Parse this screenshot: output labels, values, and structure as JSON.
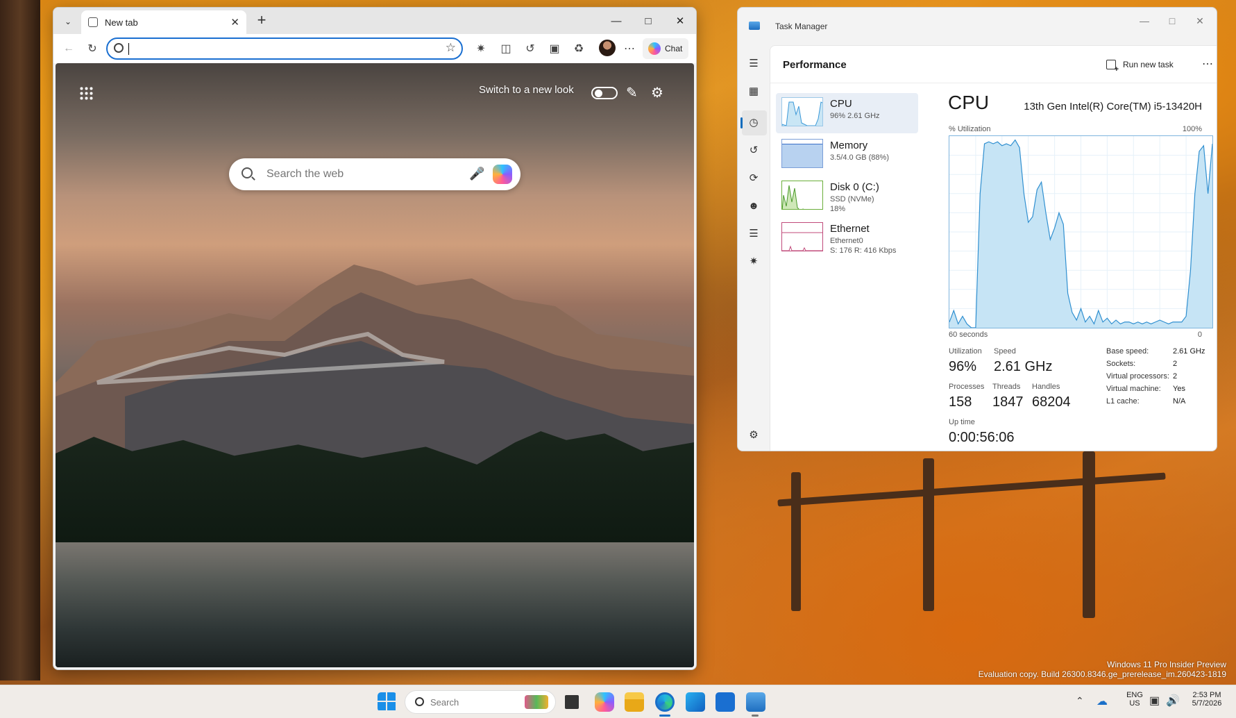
{
  "desktop": {
    "watermark_line1": "Windows 11 Pro Insider Preview",
    "watermark_line2": "Evaluation copy. Build 26300.8346.ge_prerelease_im.260423-1819"
  },
  "browser": {
    "tab_title": "New tab",
    "address_value": "",
    "chat_label": "Chat",
    "newtab": {
      "switch_label": "Switch to a new look",
      "search_placeholder": "Search the web"
    }
  },
  "task_manager": {
    "window_title": "Task Manager",
    "page_title": "Performance",
    "run_new_task": "Run new task",
    "resources": [
      {
        "name": "CPU",
        "sub1": "96%  2.61 GHz",
        "sub2": ""
      },
      {
        "name": "Memory",
        "sub1": "3.5/4.0 GB (88%)",
        "sub2": ""
      },
      {
        "name": "Disk 0 (C:)",
        "sub1": "SSD (NVMe)",
        "sub2": "18%"
      },
      {
        "name": "Ethernet",
        "sub1": "Ethernet0",
        "sub2": "S: 176  R: 416 Kbps"
      }
    ],
    "cpu": {
      "title": "CPU",
      "model": "13th Gen Intel(R) Core(TM) i5-13420H",
      "util_label": "% Utilization",
      "util_max": "100%",
      "axis_left": "60 seconds",
      "axis_right": "0",
      "stats": {
        "utilization_label": "Utilization",
        "utilization_value": "96%",
        "speed_label": "Speed",
        "speed_value": "2.61 GHz",
        "processes_label": "Processes",
        "processes_value": "158",
        "threads_label": "Threads",
        "threads_value": "1847",
        "handles_label": "Handles",
        "handles_value": "68204",
        "uptime_label": "Up time",
        "uptime_value": "0:00:56:06"
      },
      "specs": [
        {
          "label": "Base speed:",
          "value": "2.61 GHz"
        },
        {
          "label": "Sockets:",
          "value": "2"
        },
        {
          "label": "Virtual processors:",
          "value": "2"
        },
        {
          "label": "Virtual machine:",
          "value": "Yes"
        },
        {
          "label": "L1 cache:",
          "value": "N/A"
        }
      ]
    },
    "chart_data": {
      "type": "area",
      "xlim": [
        60,
        0
      ],
      "ylim": [
        0,
        100
      ],
      "x": [
        60,
        59,
        58,
        57,
        56,
        55,
        54,
        53,
        52,
        51,
        50,
        49,
        48,
        47,
        46,
        45,
        44,
        43,
        42,
        41,
        40,
        39,
        38,
        37,
        36,
        35,
        34,
        33,
        32,
        31,
        30,
        29,
        28,
        27,
        26,
        25,
        24,
        23,
        22,
        21,
        20,
        19,
        18,
        17,
        16,
        15,
        14,
        13,
        12,
        11,
        10,
        9,
        8,
        7,
        6,
        5,
        4,
        3,
        2,
        1,
        0
      ],
      "series": [
        {
          "values": [
            3,
            9,
            2,
            6,
            2,
            0,
            0,
            70,
            96,
            97,
            96,
            97,
            95,
            96,
            95,
            98,
            94,
            70,
            55,
            58,
            72,
            76,
            60,
            46,
            52,
            60,
            54,
            18,
            8,
            4,
            10,
            3,
            6,
            2,
            9,
            3,
            5,
            2,
            4,
            2,
            3,
            3,
            2,
            3,
            2,
            3,
            2,
            3,
            4,
            3,
            2,
            3,
            3,
            3,
            6,
            30,
            70,
            92,
            95,
            70,
            96
          ]
        }
      ]
    }
  },
  "taskbar": {
    "search_placeholder": "Search",
    "lang_line1": "ENG",
    "lang_line2": "US",
    "time": "2:53 PM",
    "date": "5/7/2026"
  }
}
